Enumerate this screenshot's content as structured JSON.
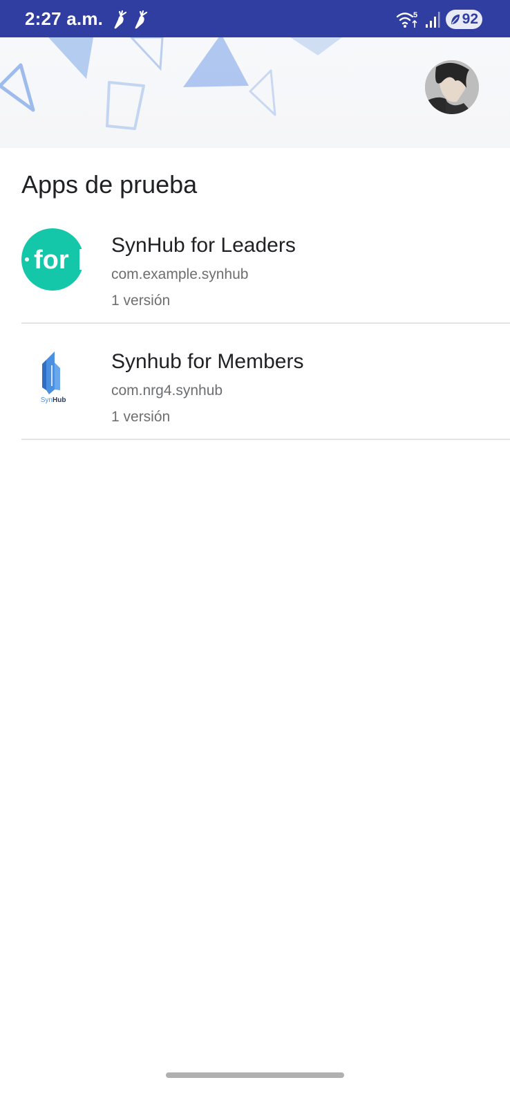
{
  "status_bar": {
    "time": "2:27 a.m.",
    "notification_icons": [
      "carrot-icon",
      "carrot-icon"
    ],
    "wifi_label": "5",
    "battery_level": "92",
    "background_color": "#2f3ea0"
  },
  "header": {
    "avatar_icon": "user-avatar"
  },
  "page": {
    "title": "Apps de prueba"
  },
  "apps": [
    {
      "name": "SynHub for Leaders",
      "package": "com.example.synhub",
      "versions": "1 versión",
      "icon_text": "for",
      "icon_color": "#13c7a8"
    },
    {
      "name": "Synhub for Members",
      "package": "com.nrg4.synhub",
      "versions": "1 versión",
      "icon_text_prefix": "Syn",
      "icon_text_suffix": "Hub",
      "icon_color": "#4a8fe0"
    }
  ]
}
